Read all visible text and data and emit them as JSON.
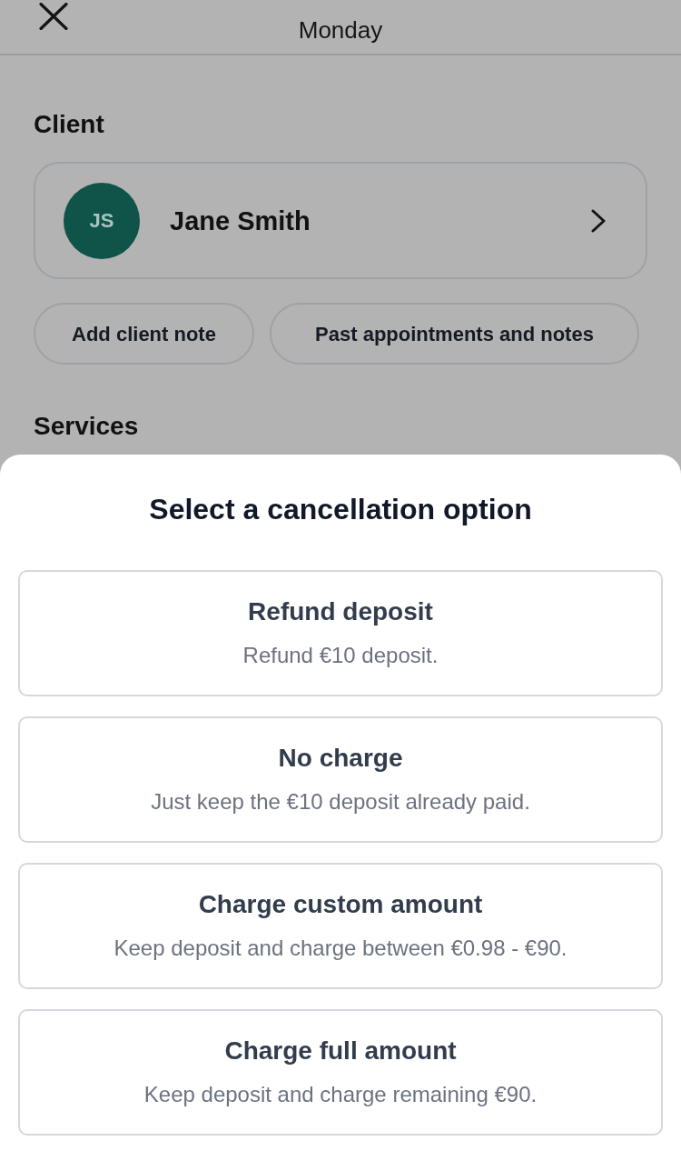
{
  "header": {
    "title": "Monday"
  },
  "client": {
    "heading": "Client",
    "initials": "JS",
    "name": "Jane Smith",
    "actions": [
      "Add client note",
      "Past appointments and notes"
    ]
  },
  "services": {
    "heading": "Services"
  },
  "sheet": {
    "title": "Select a cancellation option",
    "options": [
      {
        "title": "Refund deposit",
        "description": "Refund €10 deposit."
      },
      {
        "title": "No charge",
        "description": "Just keep the €10 deposit already paid."
      },
      {
        "title": "Charge custom amount",
        "description": "Keep deposit and charge between €0.98 - €90."
      },
      {
        "title": "Charge full amount",
        "description": "Keep deposit and charge remaining €90."
      }
    ]
  }
}
